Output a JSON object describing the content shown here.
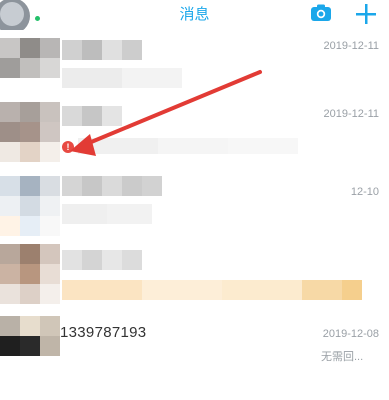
{
  "header": {
    "title": "消息",
    "camera_icon": "camera-icon",
    "add_icon": "plus-icon",
    "accent_color": "#1ba7ea"
  },
  "conversations": [
    {
      "date": "2019-12-11"
    },
    {
      "date": "2019-12-11",
      "status_icon": "error-icon",
      "status_glyph": "!"
    },
    {
      "date": "12-10"
    },
    {
      "date": ""
    },
    {
      "name": "1339787193",
      "date": "2019-12-08",
      "preview": "无需回..."
    }
  ]
}
